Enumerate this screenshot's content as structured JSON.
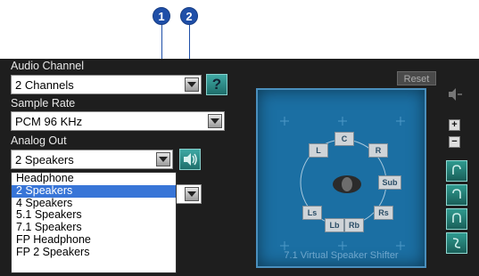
{
  "callouts": [
    "1",
    "2"
  ],
  "audio_channel": {
    "label": "Audio Channel",
    "value": "2 Channels",
    "help": "?"
  },
  "sample_rate": {
    "label": "Sample Rate",
    "value": "PCM 96 KHz"
  },
  "analog_out": {
    "label": "Analog Out",
    "value": "2 Speakers"
  },
  "dropdown": {
    "items": [
      "Headphone",
      "2 Speakers",
      "4 Speakers",
      "5.1 Speakers",
      "7.1 Speakers",
      "FP Headphone",
      "FP 2 Speakers"
    ],
    "selected": "2 Speakers"
  },
  "reset_label": "Reset",
  "speaker_labels": {
    "c": "C",
    "l": "L",
    "r": "R",
    "sub": "Sub",
    "ls": "Ls",
    "rs": "Rs",
    "lb": "Lb",
    "rb": "Rb"
  },
  "shifter_label": "7.1 Virtual Speaker Shifter",
  "zoom": {
    "plus": "+",
    "minus": "−"
  },
  "colors": {
    "panel": "#1e1e1e",
    "accent_blue": "#1f4fa8",
    "speaker_bg": "#1b6fa3",
    "selection": "#3875d7"
  }
}
